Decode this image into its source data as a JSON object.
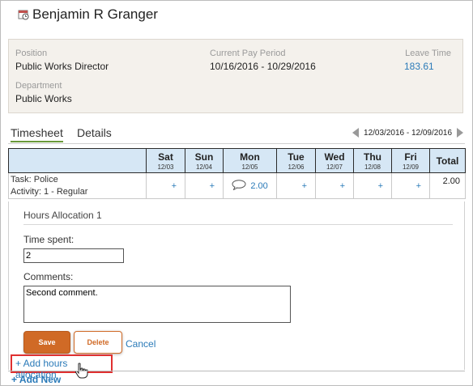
{
  "header": {
    "name": "Benjamin R Granger",
    "icon": "calendar-clock-icon"
  },
  "info": {
    "position_label": "Position",
    "position_value": "Public Works Director",
    "pay_period_label": "Current Pay Period",
    "pay_period_value": "10/16/2016 - 10/29/2016",
    "leave_label": "Leave Time",
    "leave_value": "183.61",
    "department_label": "Department",
    "department_value": "Public Works"
  },
  "tabs": [
    {
      "label": "Timesheet",
      "active": true
    },
    {
      "label": "Details",
      "active": false
    }
  ],
  "week_range": "12/03/2016 - 12/09/2016",
  "table": {
    "days": [
      {
        "day": "Sat",
        "date": "12/03"
      },
      {
        "day": "Sun",
        "date": "12/04"
      },
      {
        "day": "Mon",
        "date": "12/05"
      },
      {
        "day": "Tue",
        "date": "12/06"
      },
      {
        "day": "Wed",
        "date": "12/07"
      },
      {
        "day": "Thu",
        "date": "12/08"
      },
      {
        "day": "Fri",
        "date": "12/09"
      }
    ],
    "total_header": "Total",
    "row": {
      "task": "Task: Police",
      "activity": "Activity: 1 - Regular",
      "cells": [
        "+",
        "+",
        "2.00",
        "+",
        "+",
        "+",
        "+"
      ],
      "total": "2.00"
    }
  },
  "allocation": {
    "title": "Hours Allocation 1",
    "time_label": "Time spent:",
    "time_value": "2",
    "comments_label": "Comments:",
    "comments_value": "Second comment.",
    "save_label": "Save",
    "delete_label": "Delete",
    "cancel_label": "Cancel",
    "add_label": "+ Add hours allocation"
  },
  "add_new_label": "+ Add New",
  "colors": {
    "accent_orange": "#d06a26",
    "link_blue": "#2a7ab8",
    "header_blue": "#d6e7f5",
    "highlight_red": "#e03030"
  }
}
